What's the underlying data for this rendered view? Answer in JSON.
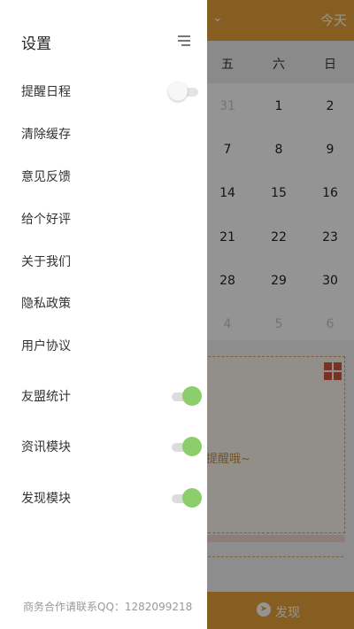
{
  "calendar": {
    "today_label": "今天",
    "weekdays": [
      "五",
      "六",
      "日"
    ],
    "rows": [
      [
        "31",
        "1",
        "2"
      ],
      [
        "7",
        "8",
        "9"
      ],
      [
        "14",
        "15",
        "16"
      ],
      [
        "21",
        "22",
        "23"
      ],
      [
        "28",
        "29",
        "30"
      ],
      [
        "4",
        "5",
        "6"
      ]
    ],
    "card_text": "提醒哦~",
    "bottom_label": "发现"
  },
  "drawer": {
    "title": "设置",
    "items": [
      {
        "label": "提醒日程",
        "toggle": "off"
      },
      {
        "label": "清除缓存"
      },
      {
        "label": "意见反馈"
      },
      {
        "label": "给个好评"
      },
      {
        "label": "关于我们"
      },
      {
        "label": "隐私政策"
      },
      {
        "label": "用户协议"
      },
      {
        "label": "友盟统计",
        "toggle": "on"
      },
      {
        "label": "资讯模块",
        "toggle": "on"
      },
      {
        "label": "发现模块",
        "toggle": "on"
      }
    ],
    "footer": "商务合作请联系QQ：1282099218"
  },
  "colors": {
    "accent": "#e9a23c",
    "toggle_on": "#8ccd6c",
    "card_icon": "#d4573d"
  },
  "icons": {
    "menu": "menu-lines-icon",
    "chevron": "chevron-down-icon",
    "card": "grid-icon",
    "discover": "compass-icon"
  }
}
